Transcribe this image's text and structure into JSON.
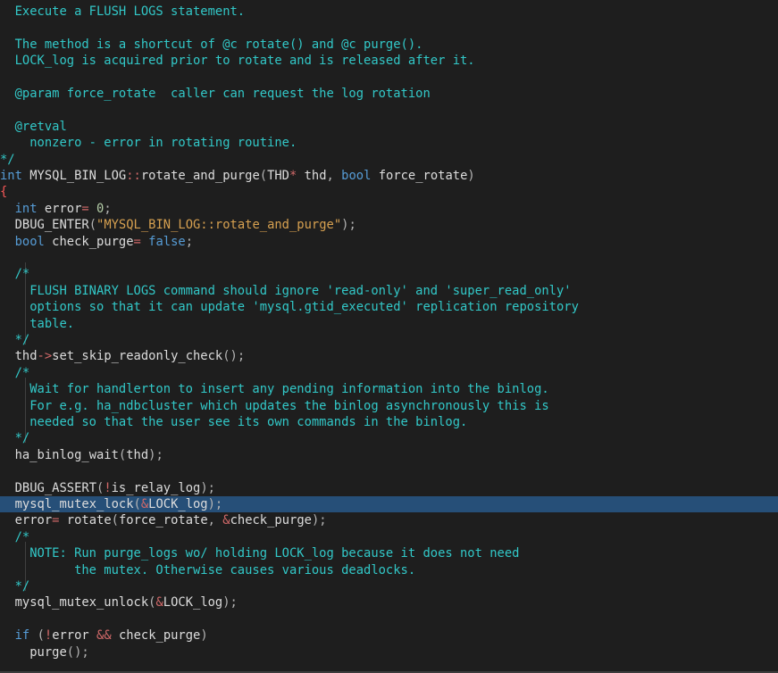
{
  "editor": {
    "lines": [
      "  Execute a FLUSH LOGS statement.",
      "",
      "  The method is a shortcut of @c rotate() and @c purge().",
      "  LOCK_log is acquired prior to rotate and is released after it.",
      "",
      "  @param force_rotate  caller can request the log rotation",
      "",
      "  @retval",
      "    nonzero - error in rotating routine.",
      "*/",
      "int MYSQL_BIN_LOG::rotate_and_purge(THD* thd, bool force_rotate)",
      "{",
      "  int error= 0;",
      "  DBUG_ENTER(\"MYSQL_BIN_LOG::rotate_and_purge\");",
      "  bool check_purge= false;",
      "",
      "  /*",
      "    FLUSH BINARY LOGS command should ignore 'read-only' and 'super_read_only'",
      "    options so that it can update 'mysql.gtid_executed' replication repository",
      "    table.",
      "  */",
      "  thd->set_skip_readonly_check();",
      "  /*",
      "    Wait for handlerton to insert any pending information into the binlog.",
      "    For e.g. ha_ndbcluster which updates the binlog asynchronously this is",
      "    needed so that the user see its own commands in the binlog.",
      "  */",
      "  ha_binlog_wait(thd);",
      "",
      "  DBUG_ASSERT(!is_relay_log);",
      "  mysql_mutex_lock(&LOCK_log);",
      "  error= rotate(force_rotate, &check_purge);",
      "  /*",
      "    NOTE: Run purge_logs wo/ holding LOCK_log because it does not need",
      "          the mutex. Otherwise causes various deadlocks.",
      "  */",
      "  mysql_mutex_unlock(&LOCK_log);",
      "",
      "  if (!error && check_purge)",
      "    purge();"
    ],
    "highlighted_line": 30,
    "colors": {
      "background": "#1e1e1e",
      "comment": "#32c8c8",
      "keyword": "#569cd6",
      "string": "#d6a050",
      "number": "#b5cea8",
      "selection": "#264f78"
    }
  }
}
